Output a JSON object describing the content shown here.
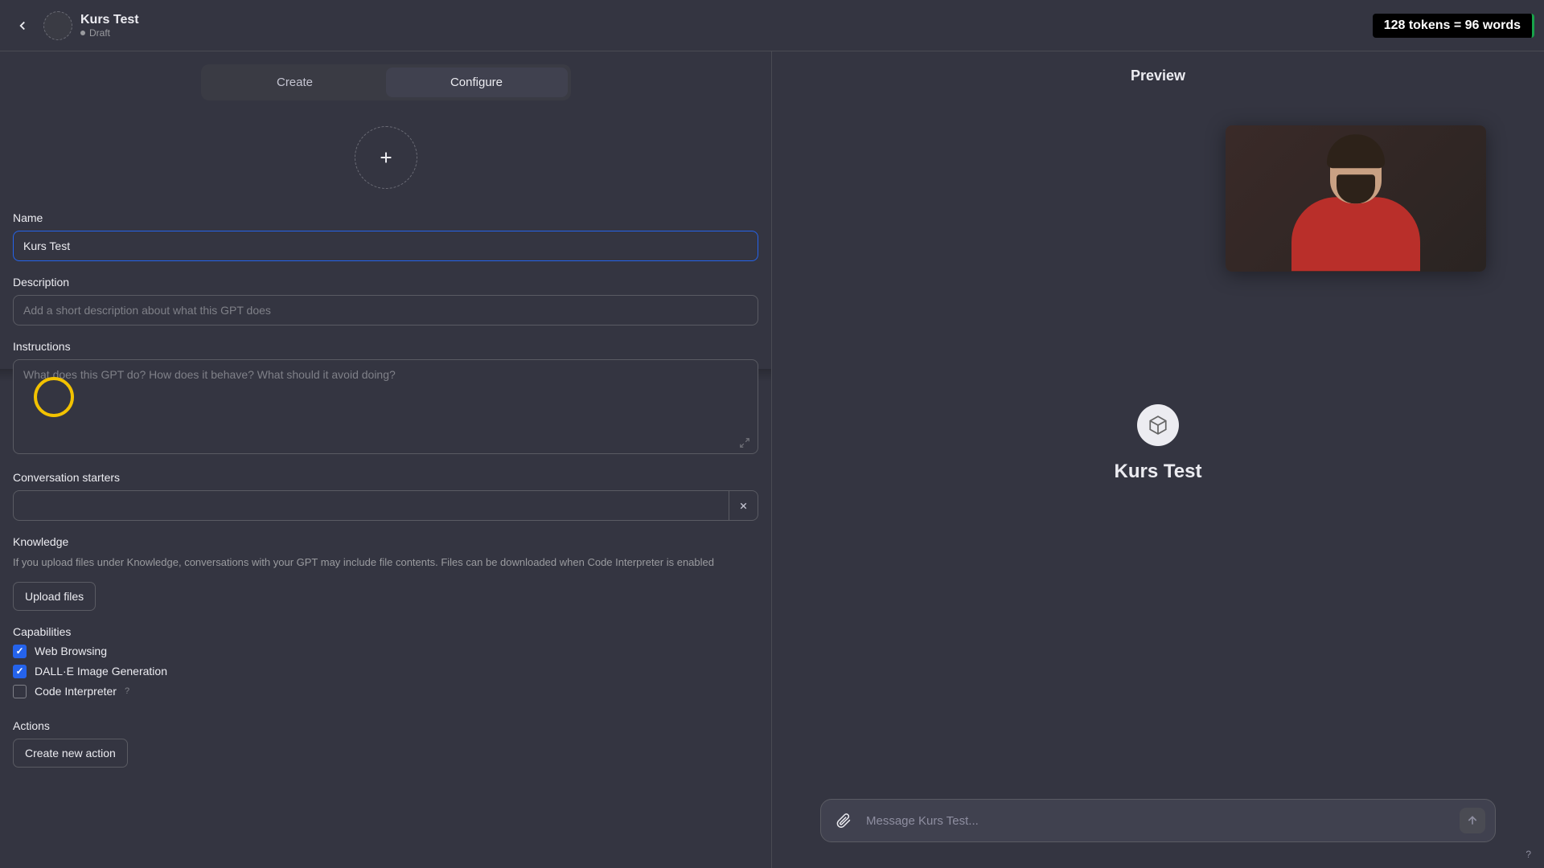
{
  "header": {
    "title": "Kurs Test",
    "status": "Draft",
    "token_badge": "128 tokens = 96 words"
  },
  "tabs": {
    "create": "Create",
    "configure": "Configure"
  },
  "form": {
    "name_label": "Name",
    "name_value": "Kurs Test",
    "description_label": "Description",
    "description_placeholder": "Add a short description about what this GPT does",
    "instructions_label": "Instructions",
    "instructions_placeholder": "What does this GPT do? How does it behave? What should it avoid doing?",
    "starters_label": "Conversation starters",
    "knowledge_label": "Knowledge",
    "knowledge_desc": "If you upload files under Knowledge, conversations with your GPT may include file contents. Files can be downloaded when Code Interpreter is enabled",
    "upload_files": "Upload files",
    "capabilities_label": "Capabilities",
    "capabilities": [
      {
        "label": "Web Browsing",
        "checked": true
      },
      {
        "label": "DALL·E Image Generation",
        "checked": true
      },
      {
        "label": "Code Interpreter",
        "checked": false,
        "info": true
      }
    ],
    "actions_label": "Actions",
    "create_action": "Create new action"
  },
  "preview": {
    "heading": "Preview",
    "title": "Kurs Test",
    "chat_placeholder": "Message Kurs Test...",
    "help": "?"
  }
}
